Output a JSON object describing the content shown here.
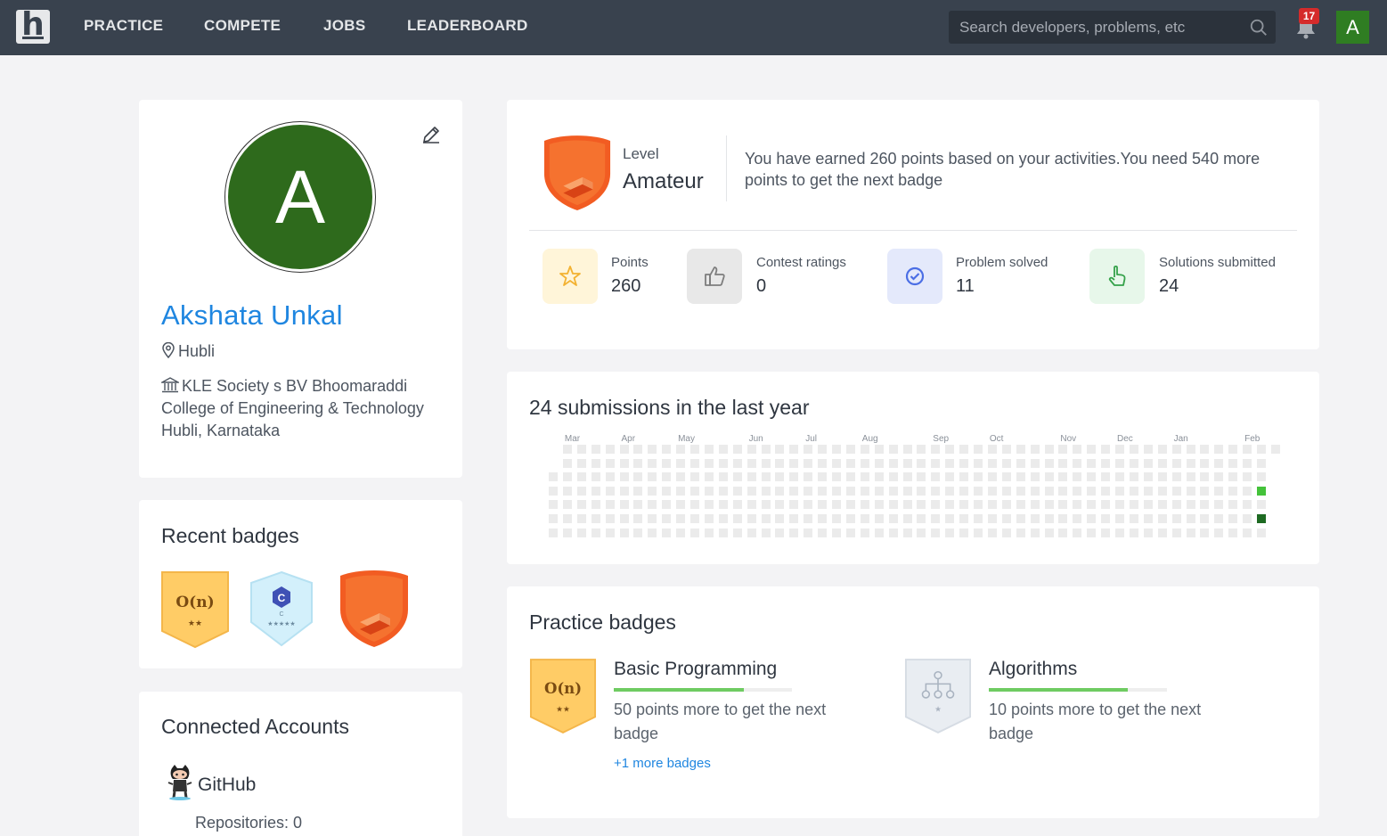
{
  "nav": {
    "logo_letter": "h",
    "links": [
      "PRACTICE",
      "COMPETE",
      "JOBS",
      "LEADERBOARD"
    ],
    "search_placeholder": "Search developers, problems, etc",
    "notification_count": "17",
    "avatar_letter": "A",
    "icons": [
      "search-icon",
      "bell-icon"
    ]
  },
  "profile": {
    "avatar_letter": "A",
    "name": "Akshata Unkal",
    "location": "Hubli",
    "institution": "KLE Society s BV Bhoomaraddi College of Engineering & Technology Hubli, Karnataka",
    "colors": {
      "avatar": "#2e6a1c",
      "name": "#1f86e0"
    }
  },
  "recent_badges": {
    "title": "Recent badges",
    "badges": [
      {
        "icon": "complexity-badge",
        "text": "O(n)",
        "stars": "★★"
      },
      {
        "icon": "c-language-badge",
        "text": "C",
        "sub": "C",
        "stars": "★★★★★"
      },
      {
        "icon": "level-badge"
      }
    ]
  },
  "connected": {
    "title": "Connected Accounts",
    "account": "GitHub",
    "repos": "Repositories: 0"
  },
  "level": {
    "label": "Level",
    "value": "Amateur",
    "message": "You have earned 260 points based on your activities.You need 540 more points to get the next badge",
    "stats": [
      {
        "label": "Points",
        "value": "260",
        "icon": "star-icon",
        "bg": "#fff5d9",
        "color": "#f3b232"
      },
      {
        "label": "Contest ratings",
        "value": "0",
        "icon": "thumbs-up-icon",
        "bg": "#e8e8e8",
        "color": "#7d7d7d"
      },
      {
        "label": "Problem solved",
        "value": "11",
        "icon": "check-circle-icon",
        "bg": "#e4e9fb",
        "color": "#4b6ee5"
      },
      {
        "label": "Solutions submitted",
        "value": "24",
        "icon": "pointer-hand-icon",
        "bg": "#e7f7ea",
        "color": "#35a24a"
      }
    ]
  },
  "submissions": {
    "title": "24 submissions in the last year",
    "months": [
      "Mar",
      "Apr",
      "May",
      "Jun",
      "Jul",
      "Aug",
      "Sep",
      "Oct",
      "Nov",
      "Dec",
      "Jan",
      "Feb"
    ],
    "active_cells": [
      {
        "week": 50,
        "day": 3,
        "color": "#44c23a"
      },
      {
        "week": 50,
        "day": 5,
        "color": "#1e6a22"
      }
    ],
    "empty_color": "#ebebeb"
  },
  "practice_badges": {
    "title": "Practice badges",
    "items": [
      {
        "name": "Basic Programming",
        "progress": 0.73,
        "message": "50 points more to get the next badge",
        "more": "+1 more badges",
        "icon": "complexity-badge",
        "badge_text": "O(n)",
        "stars": "★★"
      },
      {
        "name": "Algorithms",
        "progress": 0.78,
        "message": "10 points more to get the next badge",
        "icon": "tree-badge",
        "stars": "★"
      }
    ]
  }
}
